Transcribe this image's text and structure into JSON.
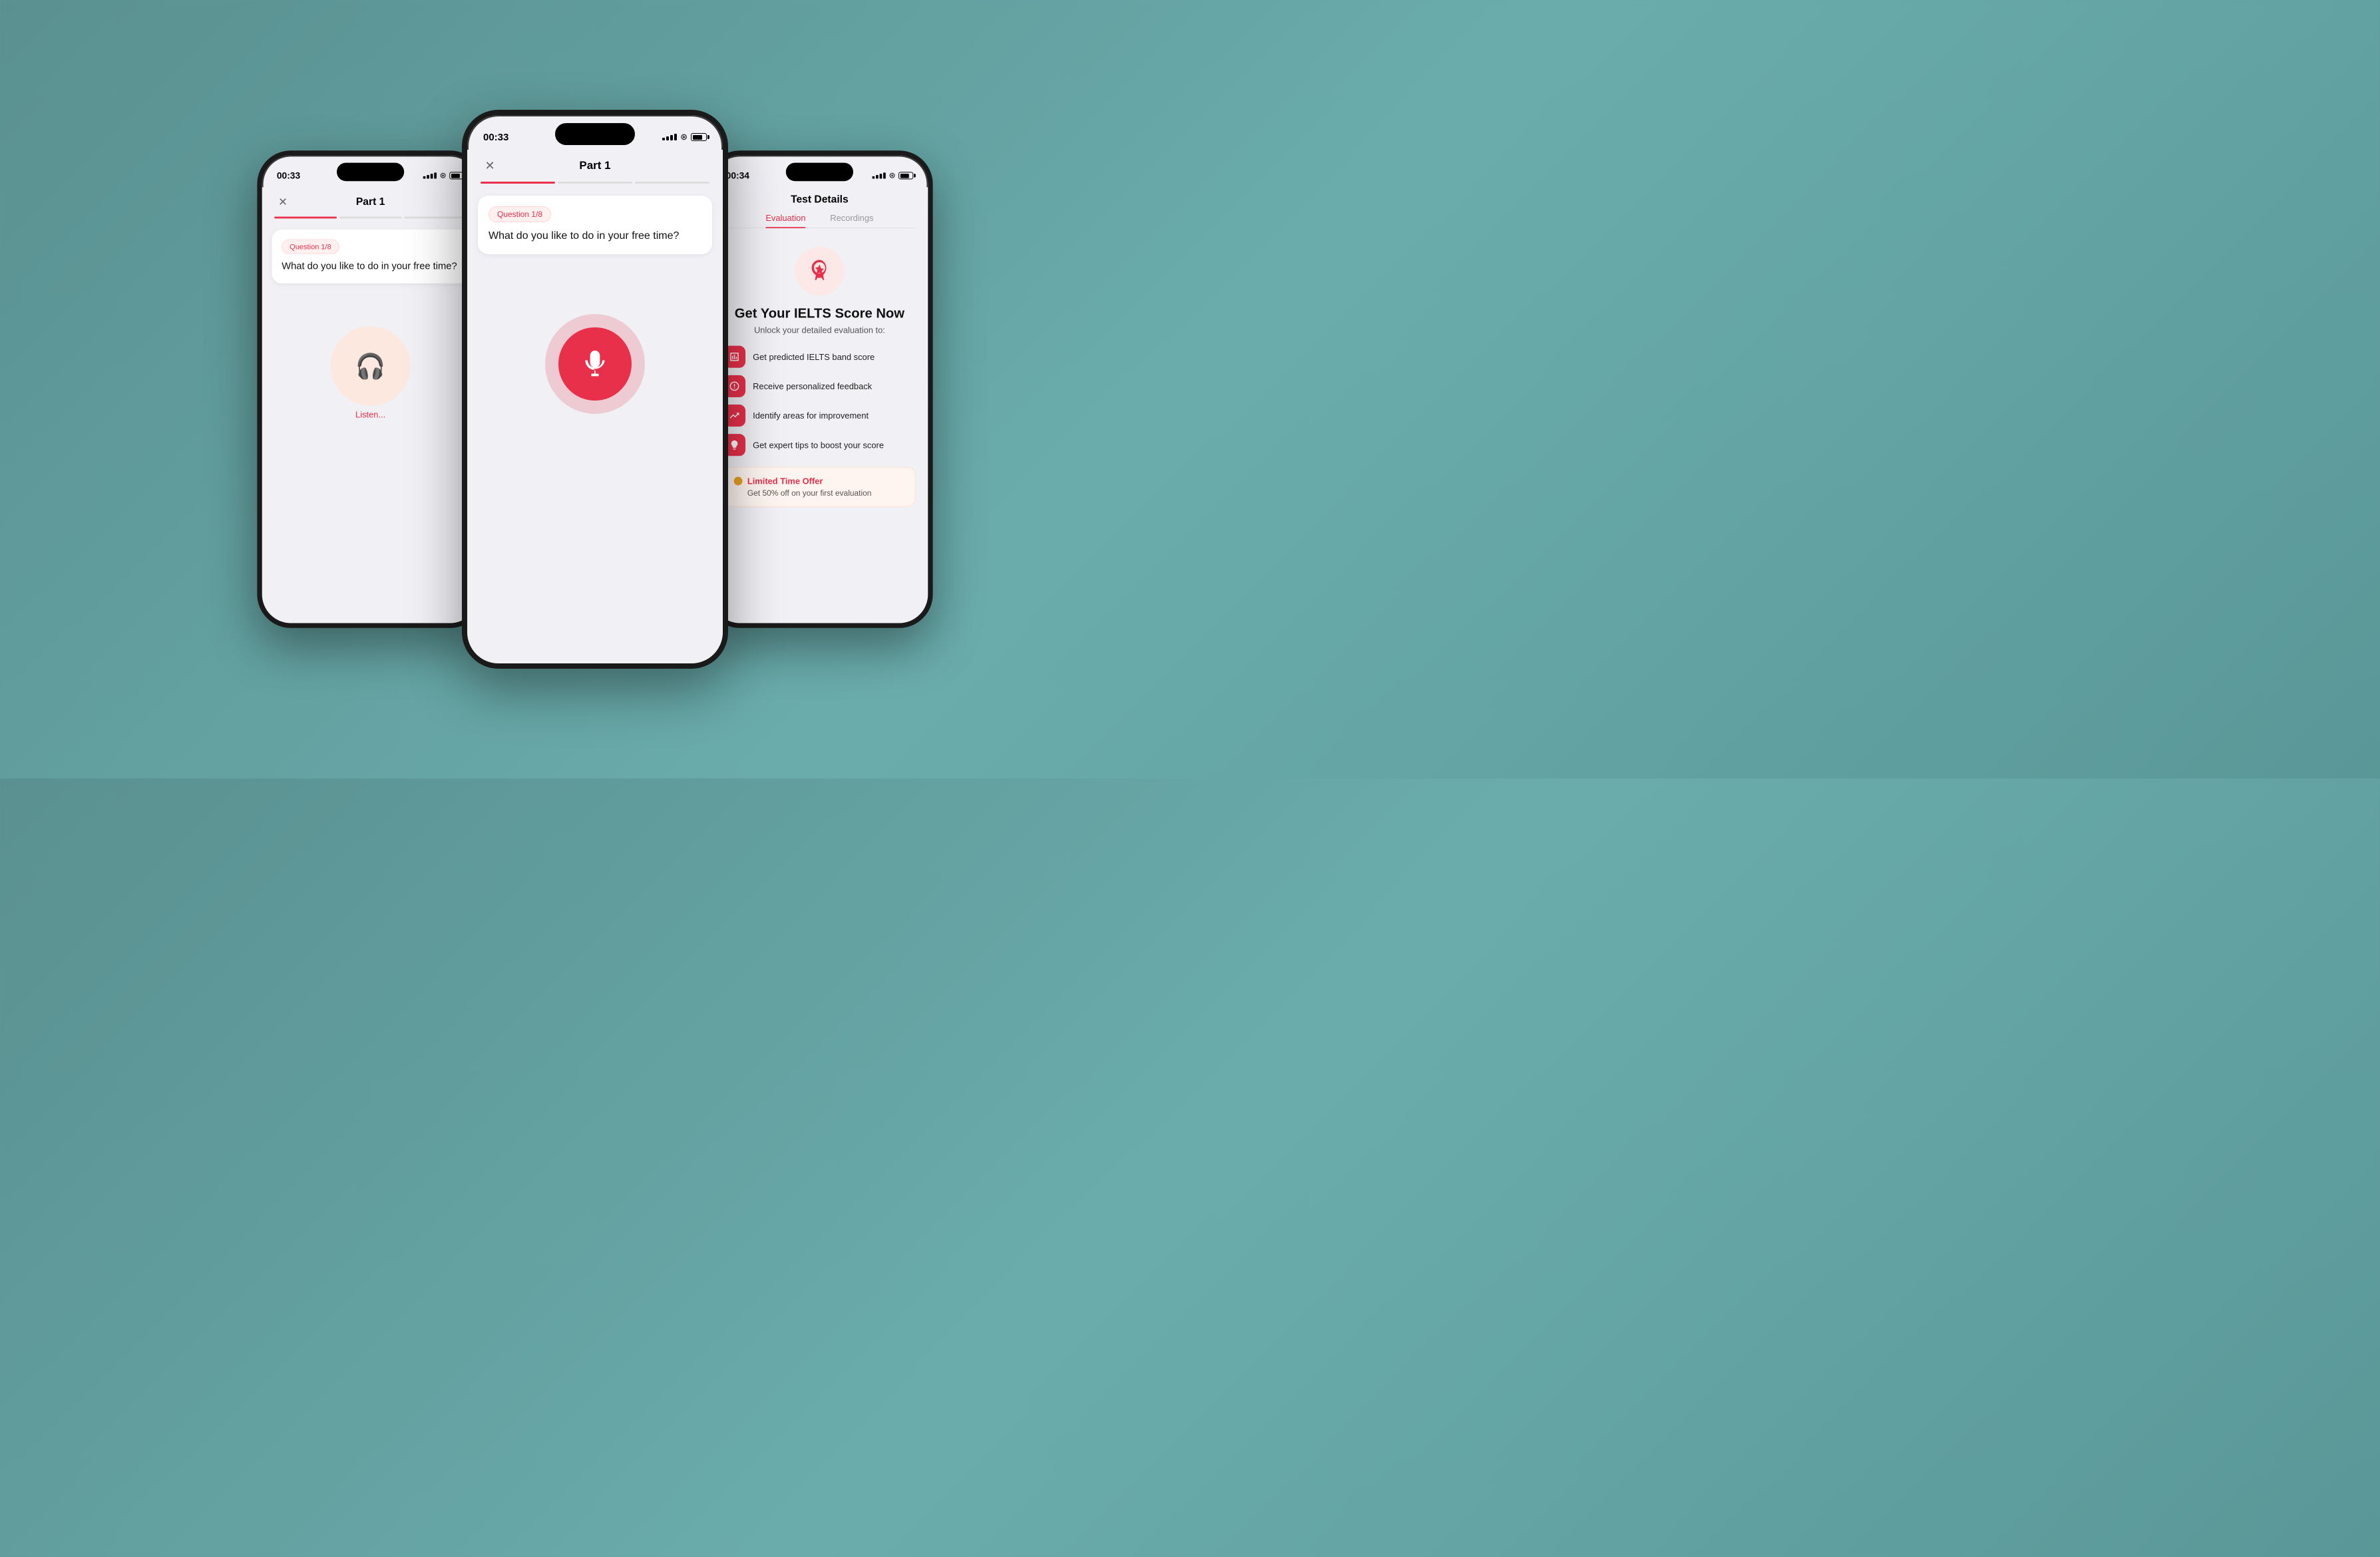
{
  "background_color": "#6aacac",
  "phones": {
    "left": {
      "time": "00:33",
      "title": "Part 1",
      "question_badge": "Question 1/8",
      "question_text": "What do you like to do in your free time?",
      "listen_label": "Listen...",
      "progress_segments": 3,
      "active_segment": 0
    },
    "center": {
      "time": "00:33",
      "title": "Part 1",
      "question_badge": "Question 1/8",
      "question_text": "What do you like to do in your free time?",
      "progress_segments": 3,
      "active_segment": 0
    },
    "right": {
      "time": "00:34",
      "title": "Test Details",
      "tab_evaluation": "Evaluation",
      "tab_recordings": "Recordings",
      "score_title": "Get Your IELTS Score Now",
      "unlock_text": "Unlock your detailed evaluation to:",
      "features": [
        {
          "icon": "chart",
          "text": "Get predicted IELTS band score"
        },
        {
          "icon": "face",
          "text": "Receive personalized feedback"
        },
        {
          "icon": "trend",
          "text": "Identify areas for improvement"
        },
        {
          "icon": "bulb",
          "text": "Get expert tips to boost your score"
        }
      ],
      "offer_title": "Limited Time Offer",
      "offer_text": "Get 50% off on your first evaluation"
    }
  }
}
